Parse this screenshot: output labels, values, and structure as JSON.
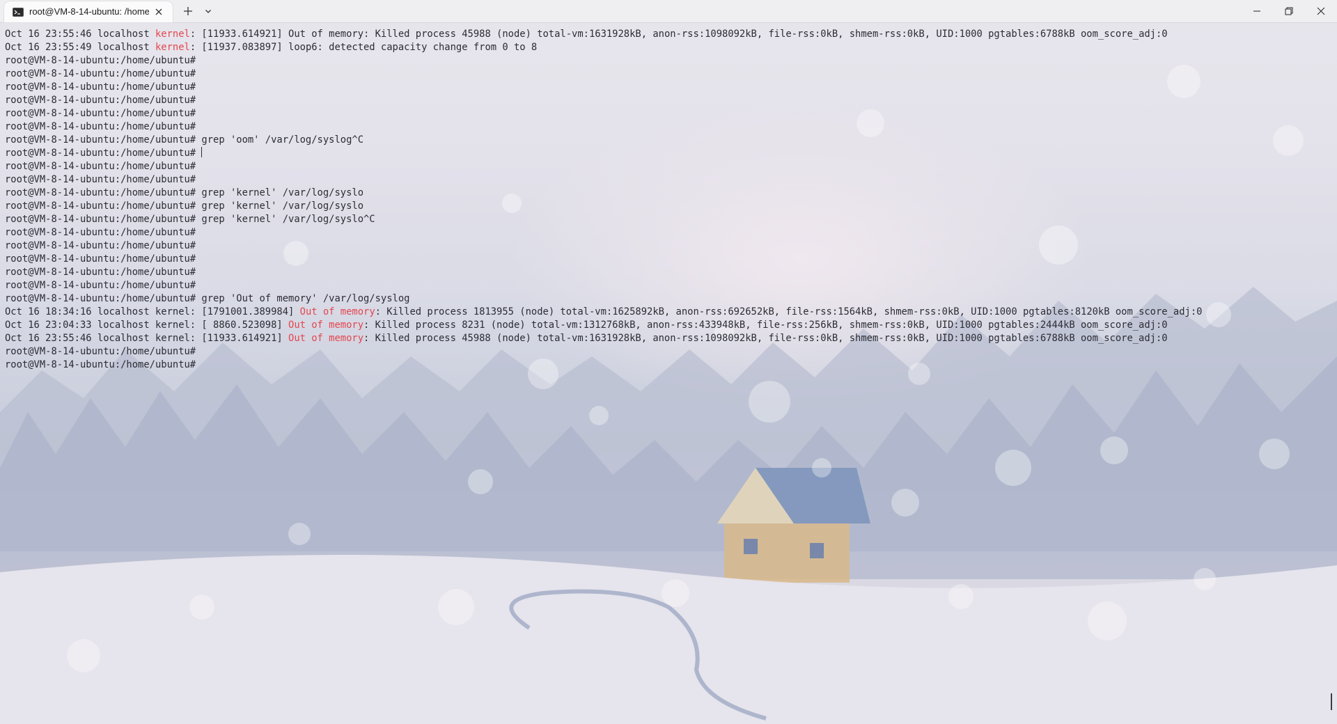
{
  "window": {
    "tab_title": "root@VM-8-14-ubuntu: /home",
    "tab_icon": "terminal-icon",
    "new_tab_icon": "plus-icon",
    "dropdown_icon": "chevron-down-icon",
    "controls": [
      "minimize-icon",
      "restore-icon",
      "close-icon"
    ]
  },
  "terminal": {
    "prompt": "root@VM-8-14-ubuntu:/home/ubuntu#",
    "highlight_color": "#e4464e",
    "lines": [
      {
        "pre": "Oct 16 23:55:46 localhost ",
        "hl": "kernel",
        "post": ": [11933.614921] Out of memory: Killed process 45988 (node) total-vm:1631928kB, anon-rss:1098092kB, file-rss:0kB, shmem-rss:0kB, UID:1000 pgtables:6788kB oom_score_adj:0"
      },
      {
        "pre": "Oct 16 23:55:49 localhost ",
        "hl": "kernel",
        "post": ": [11937.083897] loop6: detected capacity change from 0 to 8"
      },
      {
        "pre": "root@VM-8-14-ubuntu:/home/ubuntu#",
        "hl": "",
        "post": ""
      },
      {
        "pre": "root@VM-8-14-ubuntu:/home/ubuntu#",
        "hl": "",
        "post": ""
      },
      {
        "pre": "root@VM-8-14-ubuntu:/home/ubuntu#",
        "hl": "",
        "post": ""
      },
      {
        "pre": "root@VM-8-14-ubuntu:/home/ubuntu#",
        "hl": "",
        "post": ""
      },
      {
        "pre": "root@VM-8-14-ubuntu:/home/ubuntu#",
        "hl": "",
        "post": ""
      },
      {
        "pre": "root@VM-8-14-ubuntu:/home/ubuntu#",
        "hl": "",
        "post": ""
      },
      {
        "pre": "root@VM-8-14-ubuntu:/home/ubuntu# grep 'oom' /var/log/syslog^C",
        "hl": "",
        "post": ""
      },
      {
        "pre": "root@VM-8-14-ubuntu:/home/ubuntu# ",
        "hl": "",
        "post": "",
        "cursor": true
      },
      {
        "pre": "root@VM-8-14-ubuntu:/home/ubuntu#",
        "hl": "",
        "post": ""
      },
      {
        "pre": "root@VM-8-14-ubuntu:/home/ubuntu#",
        "hl": "",
        "post": ""
      },
      {
        "pre": "root@VM-8-14-ubuntu:/home/ubuntu# grep 'kernel' /var/log/syslo",
        "hl": "",
        "post": ""
      },
      {
        "pre": "root@VM-8-14-ubuntu:/home/ubuntu# grep 'kernel' /var/log/syslo",
        "hl": "",
        "post": ""
      },
      {
        "pre": "root@VM-8-14-ubuntu:/home/ubuntu# grep 'kernel' /var/log/syslo^C",
        "hl": "",
        "post": ""
      },
      {
        "pre": "root@VM-8-14-ubuntu:/home/ubuntu#",
        "hl": "",
        "post": ""
      },
      {
        "pre": "root@VM-8-14-ubuntu:/home/ubuntu#",
        "hl": "",
        "post": ""
      },
      {
        "pre": "root@VM-8-14-ubuntu:/home/ubuntu#",
        "hl": "",
        "post": ""
      },
      {
        "pre": "root@VM-8-14-ubuntu:/home/ubuntu#",
        "hl": "",
        "post": ""
      },
      {
        "pre": "root@VM-8-14-ubuntu:/home/ubuntu#",
        "hl": "",
        "post": ""
      },
      {
        "pre": "root@VM-8-14-ubuntu:/home/ubuntu# grep 'Out of memory' /var/log/syslog",
        "hl": "",
        "post": ""
      },
      {
        "pre": "Oct 16 18:34:16 localhost kernel: [1791001.389984] ",
        "hl": "Out of memory",
        "post": ": Killed process 1813955 (node) total-vm:1625892kB, anon-rss:692652kB, file-rss:1564kB, shmem-rss:0kB, UID:1000 pgtables:8120kB oom_score_adj:0"
      },
      {
        "pre": "Oct 16 23:04:33 localhost kernel: [ 8860.523098] ",
        "hl": "Out of memory",
        "post": ": Killed process 8231 (node) total-vm:1312768kB, anon-rss:433948kB, file-rss:256kB, shmem-rss:0kB, UID:1000 pgtables:2444kB oom_score_adj:0"
      },
      {
        "pre": "Oct 16 23:55:46 localhost kernel: [11933.614921] ",
        "hl": "Out of memory",
        "post": ": Killed process 45988 (node) total-vm:1631928kB, anon-rss:1098092kB, file-rss:0kB, shmem-rss:0kB, UID:1000 pgtables:6788kB oom_score_adj:0"
      },
      {
        "pre": "root@VM-8-14-ubuntu:/home/ubuntu#",
        "hl": "",
        "post": ""
      },
      {
        "pre": "root@VM-8-14-ubuntu:/home/ubuntu#",
        "hl": "",
        "post": ""
      }
    ]
  }
}
